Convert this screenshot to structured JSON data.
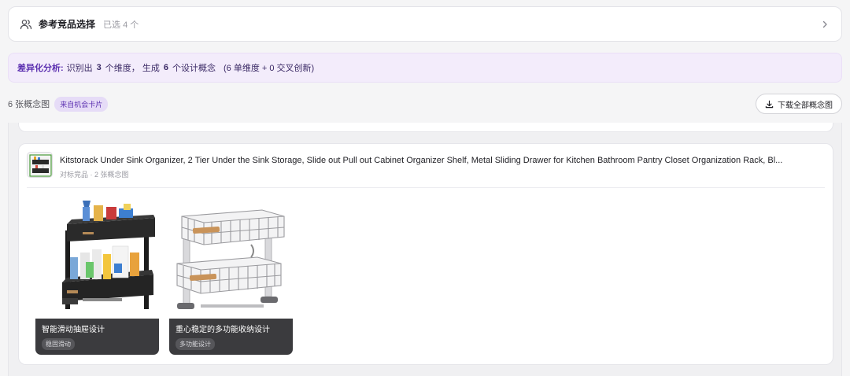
{
  "competitor_section": {
    "icon": "users-icon",
    "title": "参考竞品选择",
    "selected_count": "已选 4 个"
  },
  "analysis": {
    "label": "差异化分析:",
    "text1": "识别出",
    "dim_count": "3",
    "text2": "个维度，  生成",
    "concept_count": "6",
    "text3": "个设计概念",
    "note": "(6 单维度 + 0 交叉创新)"
  },
  "toolbar": {
    "count_text": "6 张概念图",
    "source_badge": "来自机会卡片",
    "download_label": "下载全部概念图"
  },
  "product": {
    "title": "Kitstorack Under Sink Organizer, 2 Tier Under the Sink Storage, Slide out Pull out Cabinet Organizer Shelf, Metal Sliding Drawer for Kitchen Bathroom Pantry Closet Organization Rack, Bl...",
    "meta": "对标竞品 · 2 张概念图",
    "concepts": [
      {
        "title": "智能滑动抽屉设计",
        "tag": "稳固滑动"
      },
      {
        "title": "重心稳定的多功能收纳设计",
        "tag": "多功能设计"
      }
    ]
  },
  "colors": {
    "accent_purple": "#5b2fb0",
    "banner_bg": "#f3ecfb",
    "caption_bg": "#3b3b3e"
  }
}
